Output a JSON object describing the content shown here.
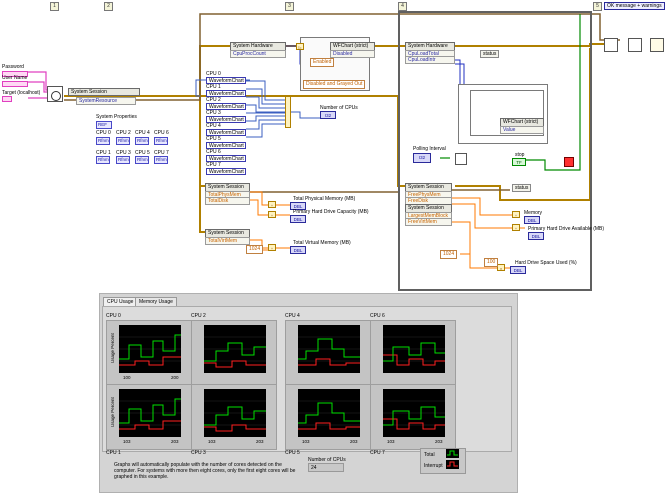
{
  "steps": [
    "1",
    "2",
    "3",
    "4",
    "5"
  ],
  "controls": {
    "password": "Password",
    "user_name": "User Name",
    "target": "Target (localhost)"
  },
  "session_open": "System Session",
  "system_resource": "SystemResource",
  "system_hardware": "System Hardware",
  "cpu_proc_count": "CpuProcCount",
  "wfchart_strict": "WFChart (strict)",
  "disabled": "Disabled",
  "enabled": "Enabled",
  "disabled_grayed": "Disabled and Grayed Out",
  "cpu_load_total": "CpuLoadTotal",
  "cpu_load_intr": "CpuLoadIntr",
  "status": "status",
  "value": "Value",
  "ok_message": "OK message + warnings",
  "cpu_refs": [
    "CPU 0",
    "CPU 1",
    "CPU 2",
    "CPU 3",
    "CPU 4",
    "CPU 5",
    "CPU 6",
    "CPU 7"
  ],
  "waveform_chart": "WaveformChart",
  "number_of_cpus": "Number of CPUs",
  "i32": "I32",
  "system_properties": "System Properties",
  "system_properties_badge": "REF",
  "refnum_tag": "Rfnm",
  "props_grid": [
    "CPU 0",
    "CPU 2",
    "CPU 4",
    "CPU 6",
    "CPU 1",
    "CPU 3",
    "CPU 5",
    "CPU 7"
  ],
  "total_phys_mem": "TotalPhysMem",
  "total_disk": "TotalDisk",
  "total_virt_mem": "TotalVirtMem",
  "free_phys_mem": "FreePhysMem",
  "free_disk": "FreeDisk",
  "largest_mem_block": "LargestMemBlock",
  "free_virt_mem": "FreeVirtMem",
  "total_physical_memory_mb": "Total Physical Memory (MB)",
  "primary_hard_drive_capacity_mb": "Primary Hard Drive Capacity (MB)",
  "total_virtual_memory_mb": "Total Virtual Memory (MB)",
  "dbl": "DBL",
  "const_1024": "1024",
  "const_100": "100",
  "polling_interval": "Polling Interval",
  "stop": "stop",
  "tf": "TF",
  "memory": "Memory",
  "primary_hard_drive_available_mb": "Primary Hard Drive Available (MB)",
  "hard_drive_space_used": "Hard Drive Space Used (%)",
  "front_panel": {
    "tabs": [
      "CPU Usage",
      "Memory Usage"
    ],
    "active_tab": 0,
    "usage_percent": "Usage Percent",
    "charts": [
      {
        "name": "CPU 0",
        "x_start": "100",
        "x_end": "200"
      },
      {
        "name": "CPU 2",
        "x_start": "",
        "x_end": ""
      },
      {
        "name": "CPU 4",
        "x_start": "",
        "x_end": ""
      },
      {
        "name": "CPU 6",
        "x_start": "",
        "x_end": ""
      },
      {
        "name": "CPU 1",
        "x_start": "103",
        "x_end": "203"
      },
      {
        "name": "CPU 3",
        "x_start": "103",
        "x_end": "203"
      },
      {
        "name": "CPU 5",
        "x_start": "103",
        "x_end": "203"
      },
      {
        "name": "CPU 7",
        "x_start": "103",
        "x_end": "203"
      }
    ],
    "note": "Graphs will automatically populate with the number of cores detected on the computer. For systems with more then eight cores, only the first eight cores will be graphed in this example.",
    "number_of_cpus_label": "Number of CPUs",
    "number_of_cpus_value": "24",
    "legend": [
      {
        "name": "Total",
        "color": "#00e000"
      },
      {
        "name": "Interrupt",
        "color": "#ff2020"
      }
    ]
  },
  "colors": {
    "refnum_wire": "#b08000",
    "numeric_wire": "#ff7a00",
    "blue_wire": "#2030c0",
    "error_wire": "#806030",
    "pink": "#e040c0",
    "total": "#00e000",
    "interrupt": "#ff2020"
  }
}
